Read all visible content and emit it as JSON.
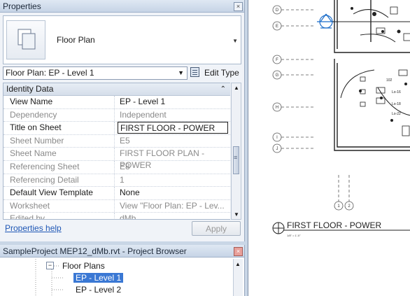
{
  "properties": {
    "title": "Properties",
    "type_name": "Floor Plan",
    "instance_selector": "Floor Plan: EP - Level 1",
    "edit_type": "Edit Type",
    "group_header": "Identity Data",
    "rows": [
      {
        "name": "View Name",
        "value": "EP - Level 1"
      },
      {
        "name": "Dependency",
        "value": "Independent"
      },
      {
        "name": "Title on Sheet",
        "value": "FIRST FLOOR - POWER"
      },
      {
        "name": "Sheet Number",
        "value": "E5"
      },
      {
        "name": "Sheet Name",
        "value": "FIRST FLOOR PLAN - POWER"
      },
      {
        "name": "Referencing Sheet",
        "value": "E8"
      },
      {
        "name": "Referencing Detail",
        "value": "1"
      },
      {
        "name": "Default View Template",
        "value": "None"
      },
      {
        "name": "Worksheet",
        "value": "View \"Floor Plan: EP - Lev..."
      },
      {
        "name": "Edited by",
        "value": "dMb"
      }
    ],
    "help_link": "Properties help",
    "apply": "Apply"
  },
  "project_browser": {
    "title": "SampleProject MEP12_dMb.rvt - Project Browser",
    "node": "Floor Plans",
    "items": [
      "EP - Level 1",
      "EP - Level 2"
    ]
  },
  "drawing": {
    "grid_labels": [
      "D",
      "E",
      "F",
      "G",
      "H",
      "I",
      "J",
      "1",
      "2"
    ],
    "view_title": "FIRST FLOOR - POWER",
    "scale_text": "1/8\" = 1'-0\"",
    "tags": [
      "102",
      "Lo-16",
      "Lo-18",
      "Lo-22"
    ]
  },
  "colors": {
    "selection": "#3a78d4",
    "panel": "#f0f3f8",
    "link": "#1f57b5"
  }
}
